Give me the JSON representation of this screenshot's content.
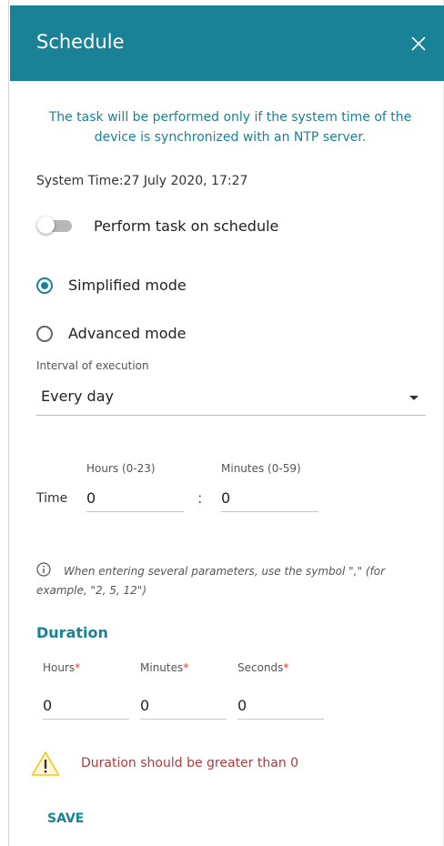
{
  "dialog": {
    "title": "Schedule",
    "close_icon": "close-icon"
  },
  "notice": "The task will be performed only if the system time of the device is synchronized with an NTP server.",
  "system_time": "System Time:27 July 2020, 17:27",
  "schedule_toggle": {
    "label": "Perform task on schedule",
    "on": false
  },
  "modes": {
    "simplified": {
      "label": "Simplified mode",
      "selected": true
    },
    "advanced": {
      "label": "Advanced mode",
      "selected": false
    }
  },
  "interval": {
    "label": "Interval of execution",
    "value": "Every day"
  },
  "time": {
    "label": "Time",
    "hours_label": "Hours (0-23)",
    "hours_value": "0",
    "separator": ":",
    "minutes_label": "Minutes (0-59)",
    "minutes_value": "0"
  },
  "info": {
    "icon": "info-icon",
    "text": "When entering several parameters, use the symbol \",\" (for example, \"2, 5, 12\")"
  },
  "duration": {
    "title": "Duration",
    "required_mark": "*",
    "hours_label": "Hours",
    "hours_value": "0",
    "minutes_label": "Minutes",
    "minutes_value": "0",
    "seconds_label": "Seconds",
    "seconds_value": "0"
  },
  "warning": {
    "icon": "warning-icon",
    "text": "Duration should be greater than 0"
  },
  "save_label": "SAVE",
  "colors": {
    "accent": "#1a8297",
    "required": "#e53935",
    "warning_text": "#b03a3a",
    "warning_icon": "#f5c518"
  }
}
